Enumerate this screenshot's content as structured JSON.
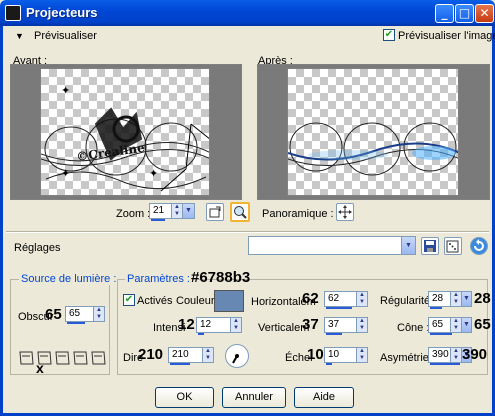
{
  "window": {
    "title": "Projecteurs"
  },
  "preview": {
    "toggle_label": "Prévisualiser",
    "checkbox_label": "Prévisualiser l'image",
    "before_label": "Avant :",
    "after_label": "Après :",
    "zoom_label": "Zoom :",
    "zoom_value": "21",
    "pan_label": "Panoramique :"
  },
  "presets": {
    "label": "Réglages",
    "value": ""
  },
  "light_source": {
    "title": "Source de lumière :",
    "obscurity_label": "Obscur",
    "obscurity_value": "65",
    "obscurity_overlay": "65",
    "selected_marker": "x"
  },
  "params": {
    "title": "Paramètres :",
    "color_overlay": "#6788b3",
    "color_hex": "#6788b3",
    "active_label": "Activés",
    "color_label": "Couleur :",
    "horizontal_label": "Horizontalem",
    "horizontal_value": "62",
    "horizontal_overlay": "62",
    "regularity_label": "Régularité :",
    "regularity_value": "28",
    "regularity_overlay": "28",
    "intensity_label": "Intensi",
    "intensity_value": "12",
    "intensity_overlay": "12",
    "vertical_label": "Verticalem",
    "vertical_value": "37",
    "vertical_overlay": "37",
    "cone_label": "Cône :",
    "cone_value": "65",
    "cone_overlay": "65",
    "direction_label": "Dire",
    "direction_value": "210",
    "direction_overlay": "210",
    "scale_label": "Échel",
    "scale_value": "10",
    "scale_overlay": "10",
    "asymmetry_label": "Asymétrie :",
    "asymmetry_value": "390",
    "asymmetry_overlay": "390"
  },
  "buttons": {
    "ok": "OK",
    "cancel": "Annuler",
    "help": "Aide"
  }
}
